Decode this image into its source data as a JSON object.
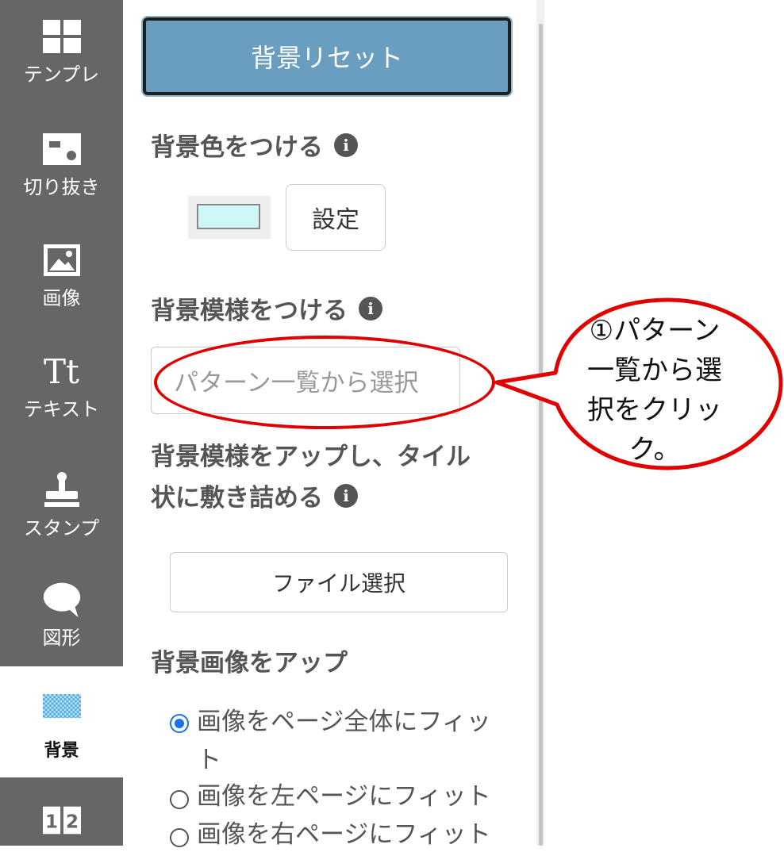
{
  "sidebar": {
    "items": [
      {
        "label": "テンプレ",
        "icon": "grid-icon"
      },
      {
        "label": "切り抜き",
        "icon": "crop-icon"
      },
      {
        "label": "画像",
        "icon": "image-icon"
      },
      {
        "label": "テキスト",
        "icon": "text-icon",
        "glyph": "Tt"
      },
      {
        "label": "スタンプ",
        "icon": "stamp-icon"
      },
      {
        "label": "図形",
        "icon": "speech-bubble-icon"
      },
      {
        "label": "背景",
        "icon": "pattern-icon",
        "active": true
      },
      {
        "label": "",
        "icon": "page-order-icon",
        "glyph_left": "1",
        "glyph_right": "2"
      }
    ]
  },
  "panel": {
    "reset_button": "背景リセット",
    "bg_color_heading": "背景色をつける",
    "set_button": "設定",
    "bg_pattern_heading": "背景模様をつける",
    "pattern_placeholder": "パターン一覧から選択",
    "tile_heading_line1": "背景模様をアップし、タイル",
    "tile_heading_line2": "状に敷き詰める",
    "file_button": "ファイル選択",
    "bg_image_heading": "背景画像をアップ",
    "radio_options": [
      {
        "label": "画像をページ全体にフィット",
        "checked": true
      },
      {
        "label": "画像を左ページにフィット",
        "checked": false
      },
      {
        "label": "画像を右ページにフィット",
        "checked": false
      }
    ],
    "info_glyph": "i"
  },
  "annotation": {
    "callout_lines": [
      "①パターン",
      "一覧から選",
      "択をクリック。"
    ]
  },
  "colors": {
    "sidebar_bg": "#666666",
    "reset_button_bg": "#6a9ec0",
    "swatch_color": "#cff6f8",
    "annotation_red": "#e00000",
    "radio_checked": "#1a73e8"
  }
}
